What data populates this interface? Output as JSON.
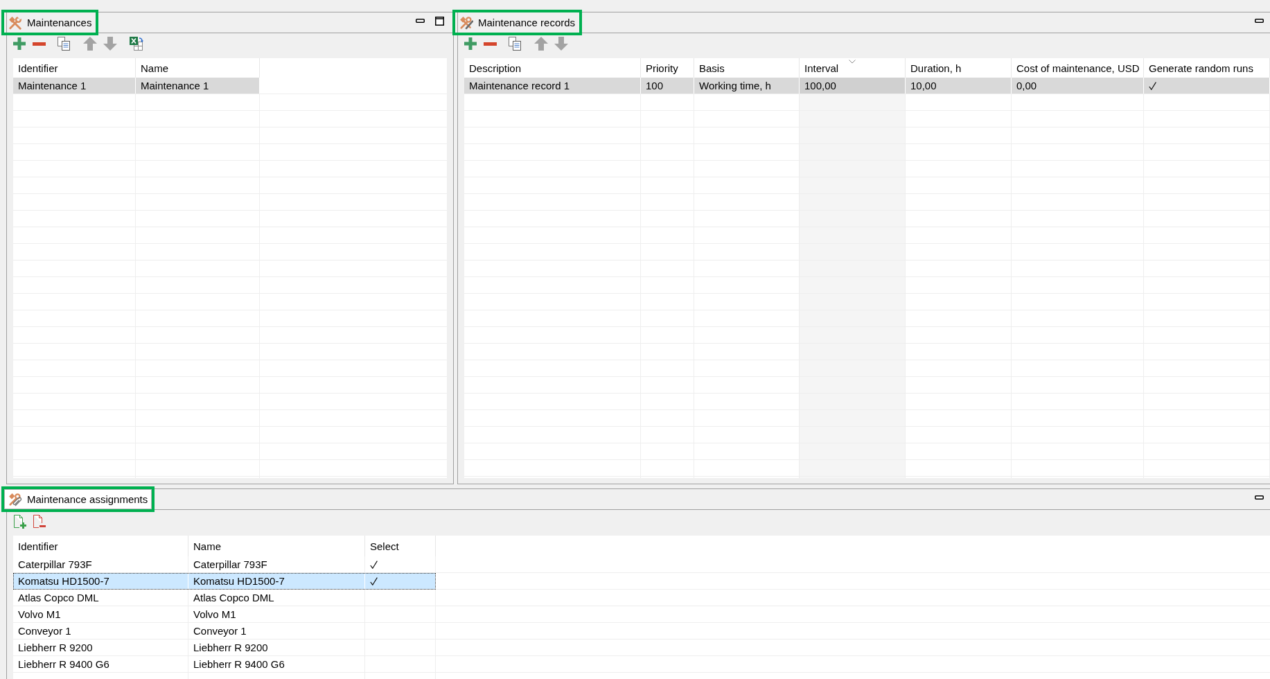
{
  "maintenances": {
    "title": "Maintenances",
    "highlighted": true,
    "active": false,
    "toolbar": [
      {
        "kind": "add",
        "disabled": false
      },
      {
        "kind": "remove",
        "disabled": false
      },
      {
        "kind": "copy",
        "disabled": false
      },
      {
        "kind": "up",
        "disabled": true
      },
      {
        "kind": "down",
        "disabled": true
      },
      {
        "kind": "excel",
        "disabled": false
      }
    ],
    "table": {
      "columns": [
        {
          "label": "Identifier",
          "kind": "text"
        },
        {
          "label": "Name",
          "kind": "text"
        }
      ],
      "rows": [
        {
          "selected": true,
          "cells": [
            "Maintenance 1",
            "Maintenance 1"
          ]
        }
      ]
    }
  },
  "maintenance_records": {
    "title": "Maintenance records",
    "highlighted": true,
    "active": false,
    "toolbar": [
      {
        "kind": "add",
        "disabled": false
      },
      {
        "kind": "remove",
        "disabled": false
      },
      {
        "kind": "copy",
        "disabled": false
      },
      {
        "kind": "up",
        "disabled": true
      },
      {
        "kind": "down",
        "disabled": true
      }
    ],
    "table": {
      "columns": [
        {
          "label": "Description",
          "kind": "text",
          "sorted": false
        },
        {
          "label": "Priority",
          "kind": "text",
          "sorted": false
        },
        {
          "label": "Basis",
          "kind": "text",
          "sorted": false
        },
        {
          "label": "Interval",
          "kind": "text",
          "sorted": true
        },
        {
          "label": "Duration, h",
          "kind": "text",
          "sorted": false
        },
        {
          "label": "Cost of maintenance, USD",
          "kind": "text",
          "sorted": false
        },
        {
          "label": "Generate random runs",
          "kind": "check",
          "sorted": false
        }
      ],
      "rows": [
        {
          "selected": true,
          "cells": [
            "Maintenance record 1",
            "100",
            "Working time, h",
            "100,00",
            "10,00",
            "0,00",
            true
          ]
        }
      ]
    }
  },
  "maintenance_assignments": {
    "title": "Maintenance assignments",
    "highlighted": true,
    "active": true,
    "toolbar": [
      {
        "kind": "add-doc",
        "disabled": false
      },
      {
        "kind": "remove-doc",
        "disabled": false
      }
    ],
    "table": {
      "columns": [
        {
          "label": "Identifier",
          "kind": "text"
        },
        {
          "label": "Name",
          "kind": "text"
        },
        {
          "label": "Select",
          "kind": "check"
        }
      ],
      "rows": [
        {
          "selected": false,
          "cells": [
            "Caterpillar 793F",
            "Caterpillar 793F",
            true
          ]
        },
        {
          "selected": true,
          "cells": [
            "Komatsu HD1500-7",
            "Komatsu HD1500-7",
            true
          ]
        },
        {
          "selected": false,
          "cells": [
            "Atlas Copco DML",
            "Atlas Copco DML",
            false
          ]
        },
        {
          "selected": false,
          "cells": [
            "Volvo M1",
            "Volvo M1",
            false
          ]
        },
        {
          "selected": false,
          "cells": [
            "Conveyor 1",
            "Conveyor 1",
            false
          ]
        },
        {
          "selected": false,
          "cells": [
            "Liebherr R 9200",
            "Liebherr R 9200",
            false
          ]
        },
        {
          "selected": false,
          "cells": [
            "Liebherr R 9400 G6",
            "Liebherr R 9400 G6",
            false
          ]
        }
      ]
    }
  }
}
